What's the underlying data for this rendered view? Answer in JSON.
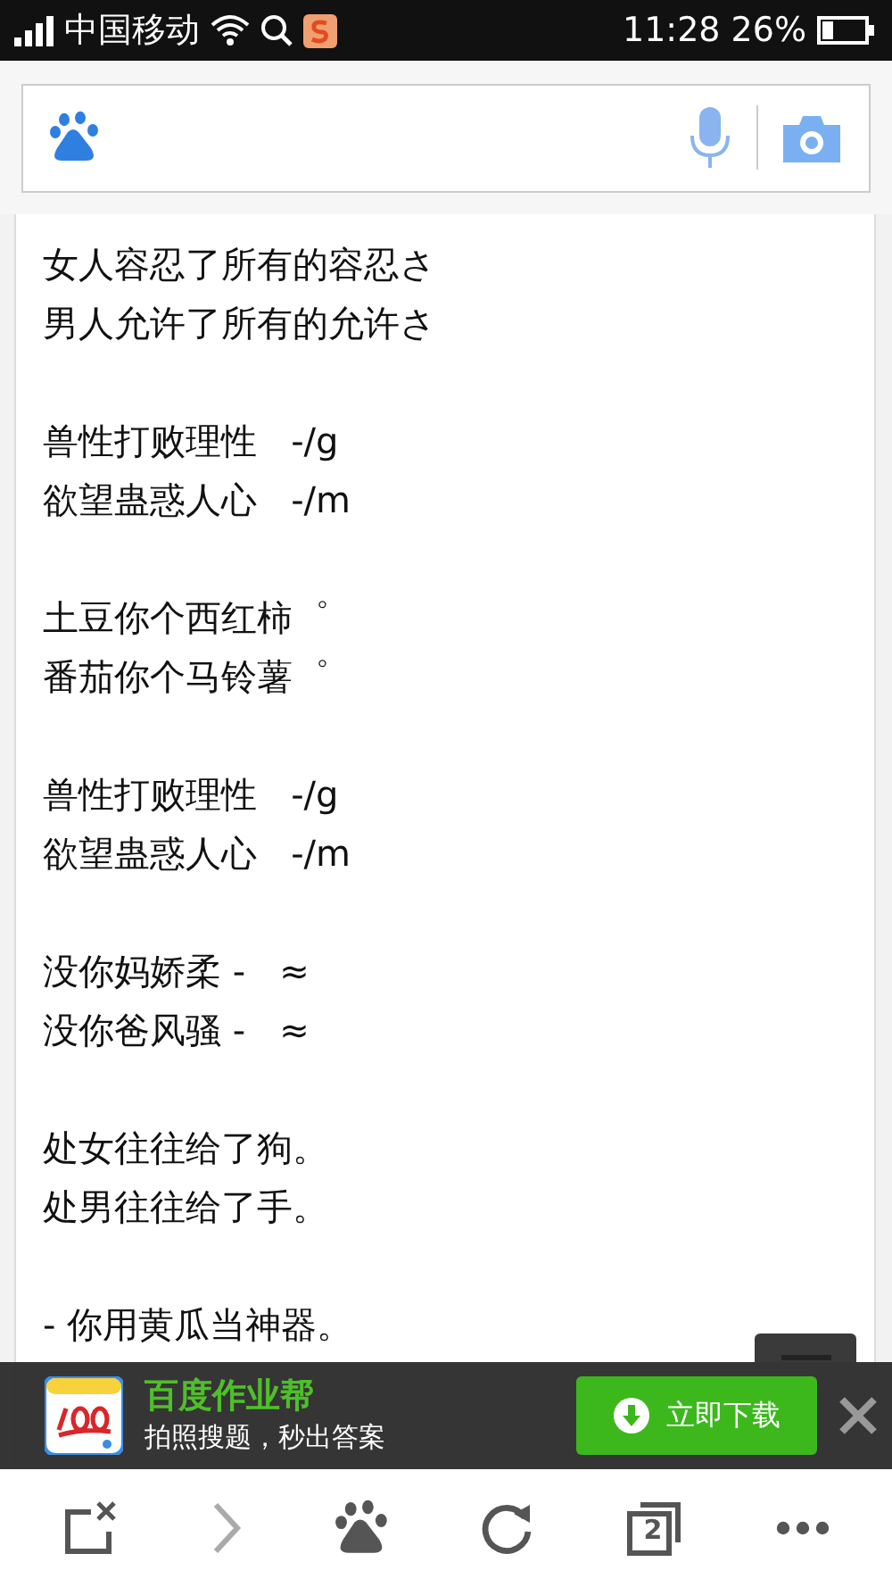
{
  "status_bar": {
    "carrier": "中国移动",
    "time": "11:28",
    "battery": "26%"
  },
  "stanzas": [
    [
      "女人容忍了所有的容忍さ",
      "男人允许了所有的允许さ"
    ],
    [
      "兽性打败理性   -/g",
      "欲望蛊惑人心   -/m"
    ],
    [
      "土豆你个西红柿゜",
      "番茄你个马铃薯゜"
    ],
    [
      "兽性打败理性   -/g",
      "欲望蛊惑人心   -/m"
    ],
    [
      "没你妈娇柔 -   ≈",
      "没你爸风骚 -   ≈"
    ],
    [
      "处女往往给了狗。",
      "处男往往给了手。"
    ],
    [
      "- 你用黄瓜当神器。"
    ]
  ],
  "ad_banner": {
    "title": "百度作业帮",
    "subtitle": "拍照搜题，秒出答案",
    "button": "立即下载"
  },
  "bottom_bar": {
    "tab_count": "2"
  }
}
